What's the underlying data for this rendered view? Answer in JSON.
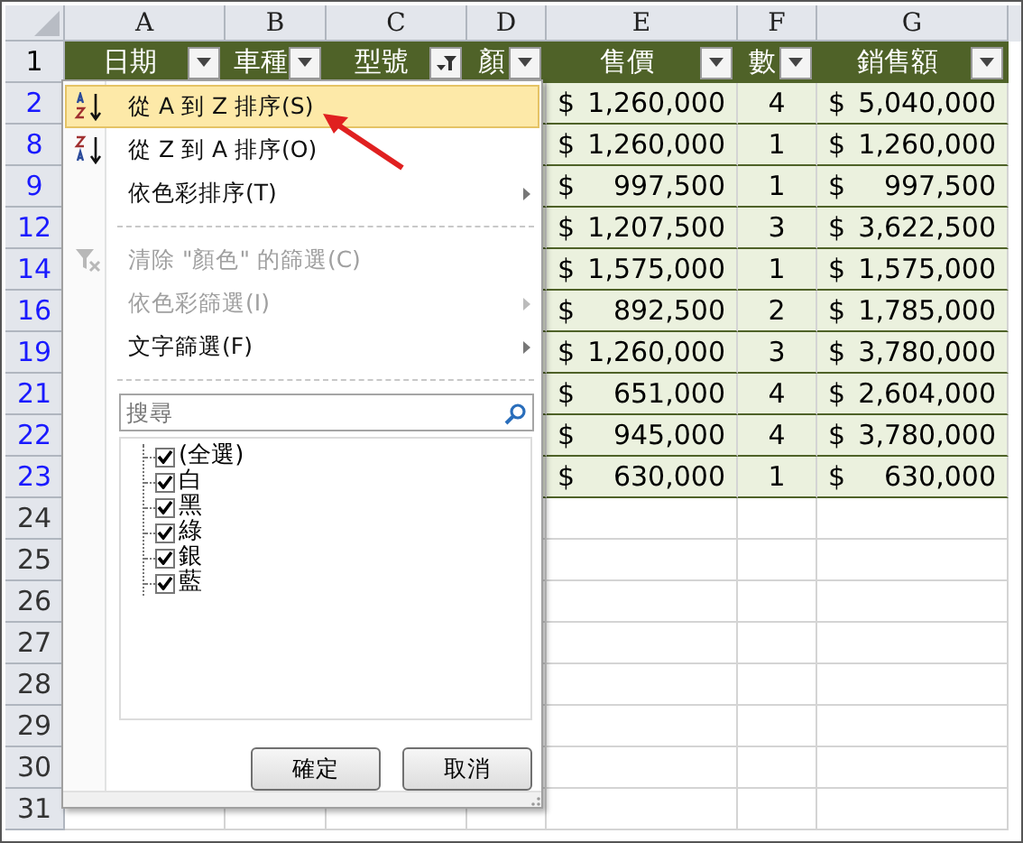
{
  "column_letters": [
    "A",
    "B",
    "C",
    "D",
    "E",
    "F",
    "G"
  ],
  "header_row": {
    "number": "1",
    "cells": [
      {
        "label": "日期",
        "filtered": false
      },
      {
        "label": "車種",
        "filtered": false
      },
      {
        "label": "型號",
        "filtered": true
      },
      {
        "label": "顏",
        "filtered": false
      },
      {
        "label": "售價",
        "filtered": false
      },
      {
        "label": "數",
        "filtered": false
      },
      {
        "label": "銷售額",
        "filtered": false
      }
    ]
  },
  "rows": [
    {
      "number": "2",
      "filtered": true,
      "price_symbol": "$",
      "price": "1,260,000",
      "quantity": "4",
      "total_symbol": "$",
      "total": "5,040,000"
    },
    {
      "number": "8",
      "filtered": true,
      "price_symbol": "$",
      "price": "1,260,000",
      "quantity": "1",
      "total_symbol": "$",
      "total": "1,260,000"
    },
    {
      "number": "9",
      "filtered": true,
      "price_symbol": "$",
      "price": "997,500",
      "quantity": "1",
      "total_symbol": "$",
      "total": "997,500"
    },
    {
      "number": "12",
      "filtered": true,
      "price_symbol": "$",
      "price": "1,207,500",
      "quantity": "3",
      "total_symbol": "$",
      "total": "3,622,500"
    },
    {
      "number": "14",
      "filtered": true,
      "price_symbol": "$",
      "price": "1,575,000",
      "quantity": "1",
      "total_symbol": "$",
      "total": "1,575,000"
    },
    {
      "number": "16",
      "filtered": true,
      "price_symbol": "$",
      "price": "892,500",
      "quantity": "2",
      "total_symbol": "$",
      "total": "1,785,000"
    },
    {
      "number": "19",
      "filtered": true,
      "price_symbol": "$",
      "price": "1,260,000",
      "quantity": "3",
      "total_symbol": "$",
      "total": "3,780,000"
    },
    {
      "number": "21",
      "filtered": true,
      "price_symbol": "$",
      "price": "651,000",
      "quantity": "4",
      "total_symbol": "$",
      "total": "2,604,000"
    },
    {
      "number": "22",
      "filtered": true,
      "price_symbol": "$",
      "price": "945,000",
      "quantity": "4",
      "total_symbol": "$",
      "total": "3,780,000"
    },
    {
      "number": "23",
      "filtered": true,
      "price_symbol": "$",
      "price": "630,000",
      "quantity": "1",
      "total_symbol": "$",
      "total": "630,000"
    },
    {
      "number": "24",
      "filtered": false
    },
    {
      "number": "25",
      "filtered": false
    },
    {
      "number": "26",
      "filtered": false
    },
    {
      "number": "27",
      "filtered": false
    },
    {
      "number": "28",
      "filtered": false
    },
    {
      "number": "29",
      "filtered": false
    },
    {
      "number": "30",
      "filtered": false
    },
    {
      "number": "31",
      "filtered": false
    }
  ],
  "filter_menu": {
    "items": [
      {
        "label": "從 A 到 Z 排序(S)",
        "selected": true,
        "disabled": false,
        "submenu": false,
        "divider_after": false
      },
      {
        "label": "從 Z 到 A 排序(O)",
        "selected": false,
        "disabled": false,
        "submenu": false,
        "divider_after": false
      },
      {
        "label": "依色彩排序(T)",
        "selected": false,
        "disabled": false,
        "submenu": true,
        "divider_after": true
      },
      {
        "label": "清除 \"顏色\" 的篩選(C)",
        "selected": false,
        "disabled": true,
        "submenu": false,
        "divider_after": false
      },
      {
        "label": "依色彩篩選(I)",
        "selected": false,
        "disabled": true,
        "submenu": true,
        "divider_after": false
      },
      {
        "label": "文字篩選(F)",
        "selected": false,
        "disabled": false,
        "submenu": true,
        "divider_after": true
      }
    ],
    "search": {
      "placeholder": "搜尋"
    },
    "values": [
      {
        "label": "(全選)",
        "checked": true
      },
      {
        "label": "白",
        "checked": true
      },
      {
        "label": "黑",
        "checked": true
      },
      {
        "label": "綠",
        "checked": true
      },
      {
        "label": "銀",
        "checked": true
      },
      {
        "label": "藍",
        "checked": true
      }
    ],
    "buttons": [
      "確定",
      "取消"
    ]
  }
}
